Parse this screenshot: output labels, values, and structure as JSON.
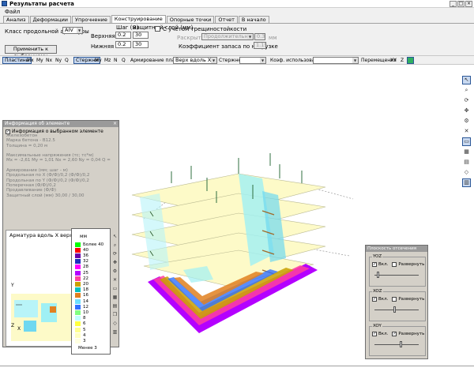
{
  "window": {
    "title": "Результаты расчета"
  },
  "menu": {
    "file": "Файл"
  },
  "tabs": [
    "Анализ",
    "Деформации",
    "Упрочнение",
    "Конструирование",
    "Опорные точки",
    "Отчет",
    "В начало"
  ],
  "settings": {
    "class_label": "Класс продольной арматуры",
    "class_value": "AIV",
    "step_header": "Шаг (м)",
    "cover_header": "Защитный слой (мм)",
    "upper_label": "Верхняя",
    "lower_label": "Нижняя",
    "upper_step": "0.2",
    "upper_cover": "30",
    "lower_step": "0.2",
    "lower_cover": "30",
    "crack_label": "С учетом трещиностойкости",
    "opening_label": "Раскрытие",
    "opening_value": "Продолжительное",
    "opening_num": "0.3",
    "opening_unit": "мм",
    "reserve_label": "Коэффициент запаса по нагрузке",
    "reserve_value": "1.15",
    "apply_button": "Применить к выбранному"
  },
  "toolbar": {
    "plates": "Пластины",
    "plate_btns": [
      "Mx",
      "My",
      "Nx",
      "Ny",
      "Q"
    ],
    "rods": "Стержни",
    "rod_btns": [
      "My",
      "Mz",
      "N",
      "Q"
    ],
    "armir_label": "Армирование пласти:",
    "armir_value": "Верх вдоль X",
    "rods_label": "Стержней",
    "coef_label": "Коэф. использования",
    "move_label": "Перемещения",
    "move_btns": [
      "XY",
      "Z"
    ]
  },
  "info_panel": {
    "title": "Информация об элементе",
    "checkbox": "Информация о выбранном элементе",
    "lines": [
      "Железобетон",
      "Марка бетона - B12.5",
      "Толщина = 0,20 м",
      "",
      "Максимальные напряжения (тс; тс*м)",
      "Mx = -2,61  My = 1,01  Nx = 2,60  Ny = 0,04  Q = 1,10",
      "",
      "Армирование (мм; шаг - м)",
      "Продольная по X (Ф/Ф)/0,2 (Ф/Ф)/0,2",
      "Продольная по Y (Ф/Ф)/0,2 (Ф/Ф)/0,2",
      "Поперечная (Ф/Ф)/0,2",
      "Продавливание (Ф/Ф)",
      "Защитный слой (мм) 30,00 / 30,00"
    ],
    "chart_title": "Арматура вдоль X верхняя",
    "axis_x": "X",
    "axis_z": "Z",
    "axis_y": "Y"
  },
  "legend": {
    "unit": "мм",
    "items": [
      {
        "label": "Более 40",
        "color": "#00ff00"
      },
      {
        "label": "40",
        "color": "#ff0000"
      },
      {
        "label": "36",
        "color": "#6a00a8"
      },
      {
        "label": "32",
        "color": "#1f2fc0"
      },
      {
        "label": "28",
        "color": "#ff00ff"
      },
      {
        "label": "25",
        "color": "#b400ff"
      },
      {
        "label": "22",
        "color": "#ff40a0"
      },
      {
        "label": "20",
        "color": "#c8a000"
      },
      {
        "label": "18",
        "color": "#00c0c0"
      },
      {
        "label": "16",
        "color": "#e08020"
      },
      {
        "label": "14",
        "color": "#6ee0ff"
      },
      {
        "label": "12",
        "color": "#3070ff"
      },
      {
        "label": "10",
        "color": "#80ff80"
      },
      {
        "label": "8",
        "color": "#c0ffff"
      },
      {
        "label": "6",
        "color": "#ffff40"
      },
      {
        "label": "5",
        "color": "#ffff90"
      },
      {
        "label": "4",
        "color": "#ffffc0"
      },
      {
        "label": "3",
        "color": "#ffffe0"
      }
    ],
    "min_label": "Менее 3"
  },
  "planes": {
    "title": "Плоскость отсечения",
    "groups": [
      {
        "name": "YOZ",
        "on_label": "Вкл.",
        "unfold_label": "Развернуть",
        "on": true,
        "unfold": false,
        "pos": 0.05
      },
      {
        "name": "XOZ",
        "on_label": "Вкл.",
        "unfold_label": "Развернуть",
        "on": true,
        "unfold": false,
        "pos": 0.45
      },
      {
        "name": "XOY",
        "on_label": "Вкл.",
        "unfold_label": "Развернуть",
        "on": true,
        "unfold": true,
        "pos": 0.6
      }
    ]
  }
}
